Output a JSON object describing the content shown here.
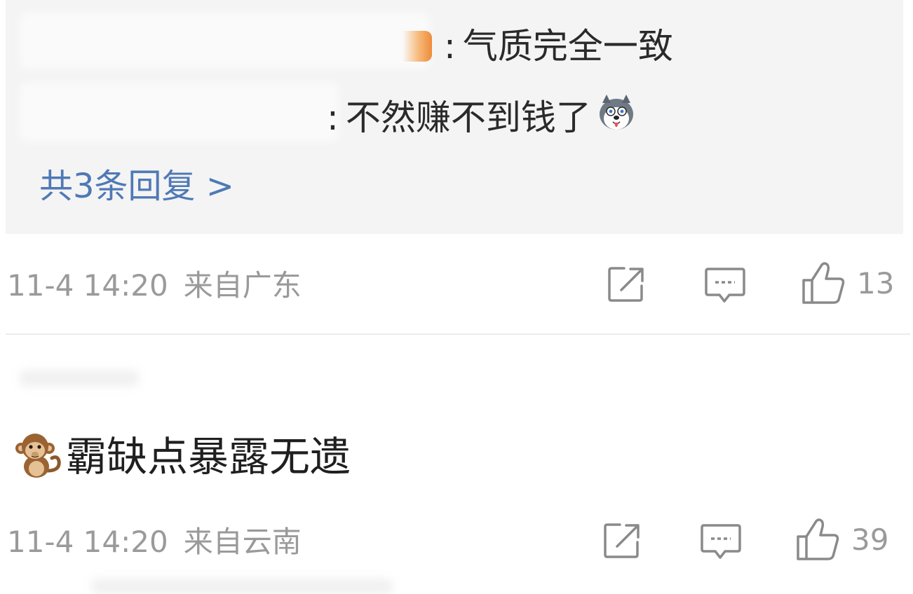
{
  "replies": [
    {
      "text": "气质完全一致"
    },
    {
      "text": "不然赚不到钱了",
      "emoji": "husky-emoji"
    }
  ],
  "more_replies": {
    "label": "共3条回复 >"
  },
  "comments": [
    {
      "timestamp": "11-4 14:20",
      "location": "来自广东",
      "likes": "13",
      "actions": [
        "share-icon",
        "comment-icon",
        "thumbs-up-icon"
      ]
    },
    {
      "emoji": "monkey-emoji",
      "text": "霸缺点暴露无遗",
      "timestamp": "11-4 14:20",
      "location": "来自云南",
      "likes": "39",
      "actions": [
        "share-icon",
        "comment-icon",
        "thumbs-up-icon"
      ]
    }
  ],
  "colors": {
    "link": "#4f79b6",
    "meta": "#9a9a9a",
    "reply_bg": "#f4f4f4"
  }
}
